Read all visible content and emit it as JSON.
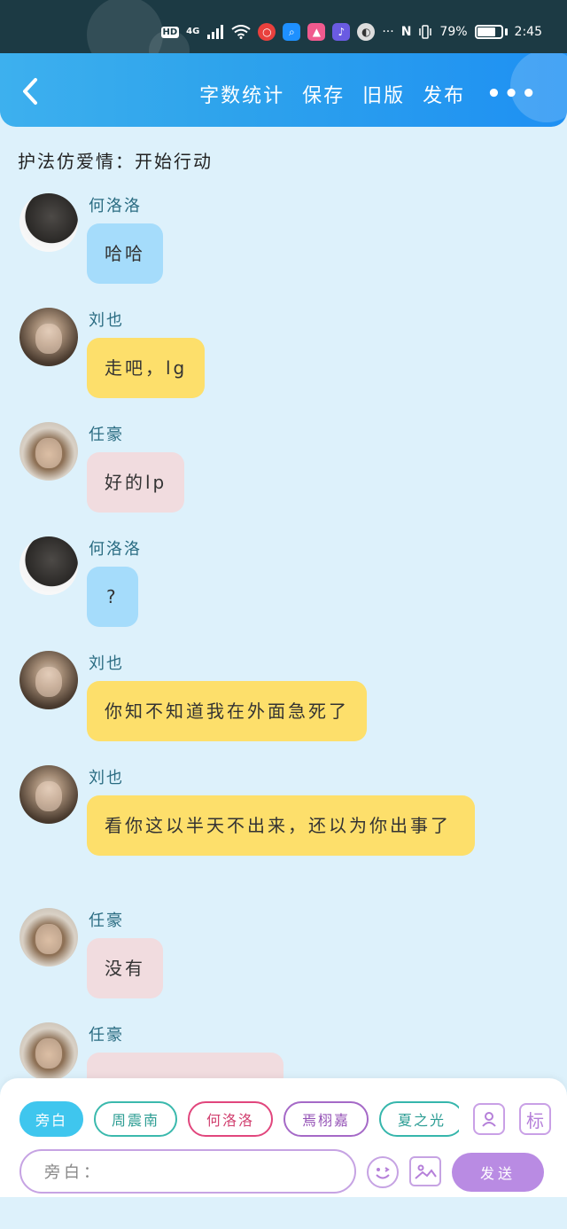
{
  "status_bar": {
    "hd": "HD",
    "network": "4G",
    "battery_percent": "79%",
    "battery_level": 0.79,
    "time": "2:45",
    "nfc": "N",
    "more": "···"
  },
  "header": {
    "back_icon": "chevron-left-icon",
    "actions": [
      "字数统计",
      "保存",
      "旧版",
      "发布"
    ],
    "more": "•••"
  },
  "chat": {
    "title": "护法仿爱情：开始行动",
    "messages": [
      {
        "sender": "何洛洛",
        "text": "哈哈",
        "style": "he"
      },
      {
        "sender": "刘也",
        "text": "走吧，lg",
        "style": "liu"
      },
      {
        "sender": "任豪",
        "text": "好的lp",
        "style": "ren"
      },
      {
        "sender": "何洛洛",
        "text": "?",
        "style": "he"
      },
      {
        "sender": "刘也",
        "text": "你知不知道我在外面急死了",
        "style": "liu"
      },
      {
        "sender": "刘也",
        "text": "看你这以半天不出来，还以为你出事了",
        "style": "liu"
      },
      {
        "sender": "任豪",
        "text": "没有",
        "style": "ren"
      },
      {
        "sender": "任豪",
        "text": "",
        "style": "ren"
      }
    ]
  },
  "composer": {
    "roles": [
      "旁白",
      "周震南",
      "何洛洛",
      "焉栩嘉",
      "夏之光"
    ],
    "active_role": "旁白",
    "contact_icon": "contact-card-icon",
    "tag_label": "标",
    "input_placeholder": "旁白：",
    "emoji_icon": "smile-icon",
    "image_icon": "image-icon",
    "send_label": "发送"
  }
}
